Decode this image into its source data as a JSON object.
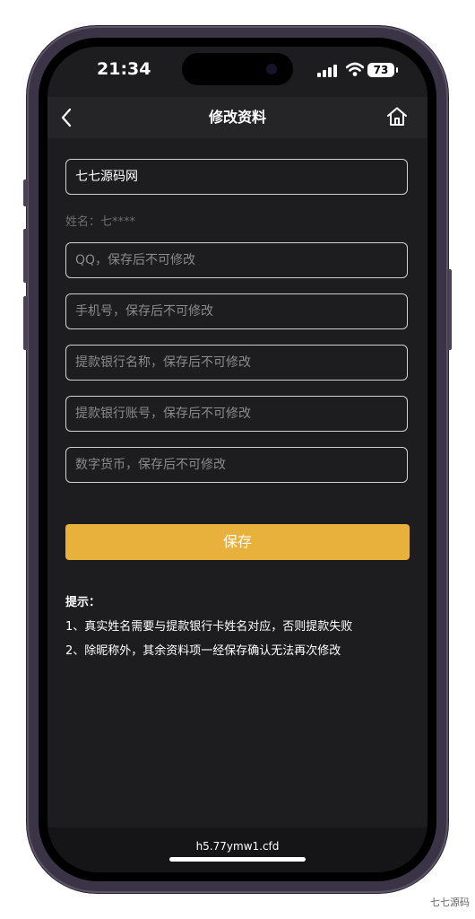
{
  "status_bar": {
    "time": "21:34",
    "battery": "73"
  },
  "nav": {
    "title": "修改资料"
  },
  "form": {
    "nickname_value": "七七源码网",
    "name_label": "姓名：七****",
    "qq_placeholder": "QQ，保存后不可修改",
    "phone_placeholder": "手机号，保存后不可修改",
    "bank_name_placeholder": "提款银行名称，保存后不可修改",
    "bank_account_placeholder": "提款银行账号，保存后不可修改",
    "crypto_placeholder": "数字货币，保存后不可修改",
    "save_label": "保存"
  },
  "tips": {
    "title": "提示：",
    "line1": "1、真实姓名需要与提款银行卡姓名对应，否则提款失败",
    "line2": "2、除昵称外，其余资料项一经保存确认无法再次修改"
  },
  "footer": {
    "url": "h5.77ymw1.cfd"
  },
  "watermark": {
    "text": "七七源码"
  },
  "colors": {
    "accent": "#e8b13c",
    "background": "#1d1d1f"
  },
  "icons": {
    "back": "chevron-left-icon",
    "home": "home-icon"
  }
}
